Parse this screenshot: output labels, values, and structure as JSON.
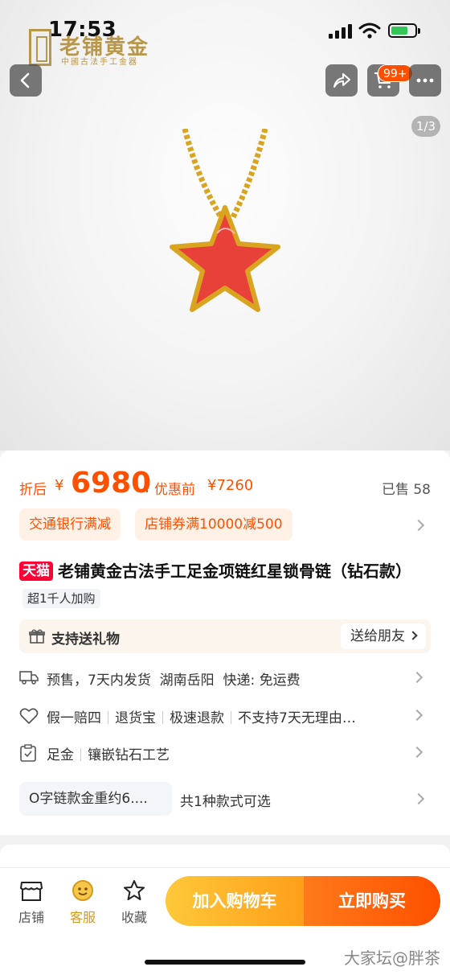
{
  "status_bar": {
    "time": "17:53"
  },
  "brand": {
    "name": "老铺黄金",
    "tagline": "中國古法手工金器"
  },
  "top_actions": {
    "cart_badge": "99+",
    "image_counter": "1/3"
  },
  "price": {
    "prefix": "折后",
    "currency": "¥",
    "amount": "6980",
    "original_label": "优惠前",
    "original_price": "¥7260",
    "sold_label": "已售 58"
  },
  "promos": [
    "交通银行满减",
    "店铺券满10000减500"
  ],
  "product": {
    "platform_tag": "天猫",
    "title": "老铺黄金古法手工足金项链红星锁骨链（钻石款）",
    "hot_tag": "超1千人加购"
  },
  "gift": {
    "label": "支持送礼物",
    "button": "送给朋友"
  },
  "shipping": {
    "presale": "预售，7天内发货",
    "origin": "湖南岳阳",
    "express": "快递: 免运费"
  },
  "guarantees": [
    "假一赔四",
    "退货宝",
    "极速退款",
    "不支持7天无理由…"
  ],
  "attributes": [
    "足金",
    "镶嵌钻石工艺"
  ],
  "spec": {
    "selected": "O字链款金重约6....",
    "count_text": "共1种款式可选"
  },
  "bottom_bar": {
    "shop": "店铺",
    "service": "客服",
    "favorite": "收藏",
    "add_to_cart": "加入购物车",
    "buy_now": "立即购买"
  },
  "watermark": "大家坛@胖茶",
  "colors": {
    "accent": "#ff5000",
    "tmall": "#ff0036",
    "gold": "#b8964a"
  }
}
